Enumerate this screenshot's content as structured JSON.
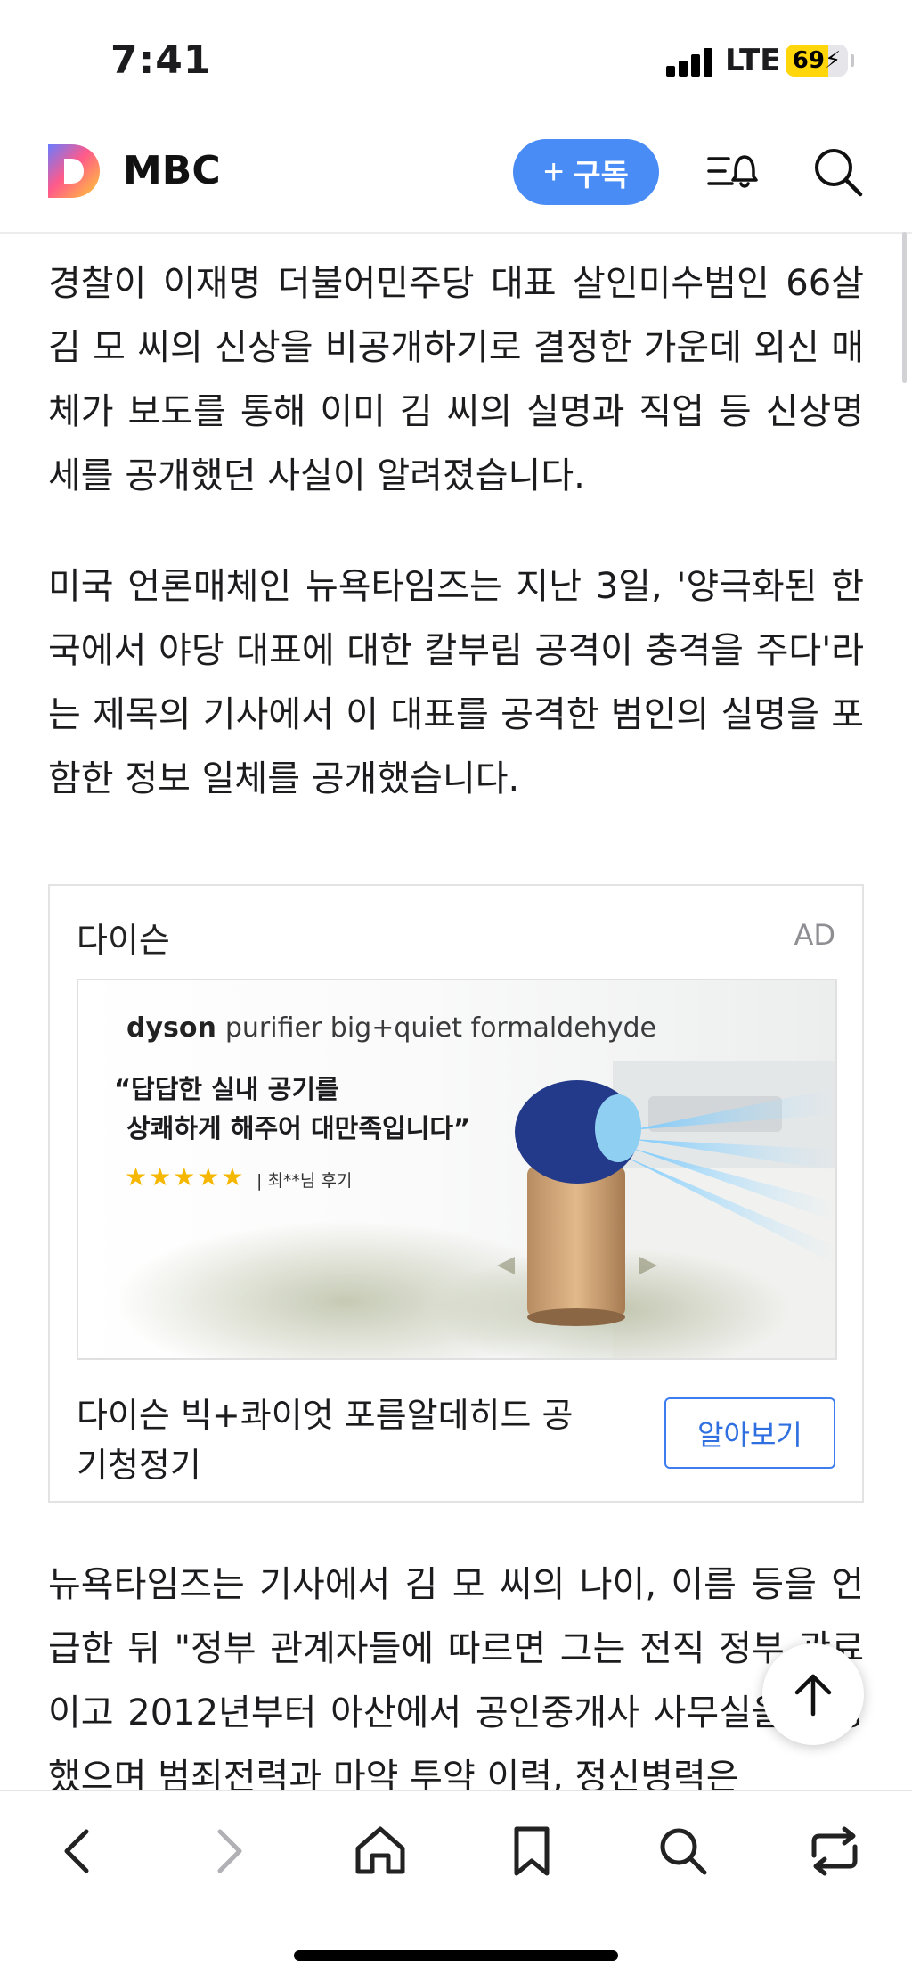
{
  "status_bar": {
    "time": "7:41",
    "network": "LTE",
    "battery": "69",
    "battery_level": 0.69,
    "battery_color": "#ffd60a"
  },
  "header": {
    "brand": "MBC",
    "subscribe_label": "구독",
    "icons": [
      "menu-bell-icon",
      "search-icon"
    ],
    "accent_color": "#4a8cf5"
  },
  "article": {
    "paragraphs": [
      "경찰이 이재명 더불어민주당 대표 살인미수범인 66살 김 모 씨의 신상을 비공개하기로 결정한 가운데 외신 매체가 보도를 통해 이미 김 씨의 실명과 직업 등 신상명세를 공개했던 사실이 알려졌습니다.",
      "미국 언론매체인 뉴욕타임즈는 지난 3일, '양극화된 한국에서 야당 대표에 대한 칼부림 공격이 충격을 주다'라는 제목의 기사에서 이 대표를 공격한 범인의 실명을 포함한 정보 일체를 공개했습니다.",
      "뉴욕타임즈는 기사에서 김 모 씨의 나이, 이름 등을 언급한 뒤 \"정부 관계자들에 따르면 그는 전직 정부 관료이고 2012년부터 아산에서 공인중개사 사무실을 운영했으며 범죄전력과 마약 투약 이력, 정신병력은"
    ]
  },
  "ad": {
    "advertiser": "다이슨",
    "badge": "AD",
    "image": {
      "brand": "dyson",
      "product_line": "purifier big+quiet formaldehyde",
      "quote_line1": "“답답한 실내 공기를",
      "quote_line2": "상쾌하게 해주어 대만족입니다”",
      "stars": "★★★★★",
      "review": "| 최**님 후기"
    },
    "title": "다이슨 빅+콰이엇 포름알데히드 공기청정기",
    "cta": "알아보기",
    "cta_color": "#3d7df0"
  },
  "toolbar": {
    "icons": [
      "back-icon",
      "forward-icon",
      "home-icon",
      "bookmark-icon",
      "search-icon",
      "share-icon"
    ]
  }
}
